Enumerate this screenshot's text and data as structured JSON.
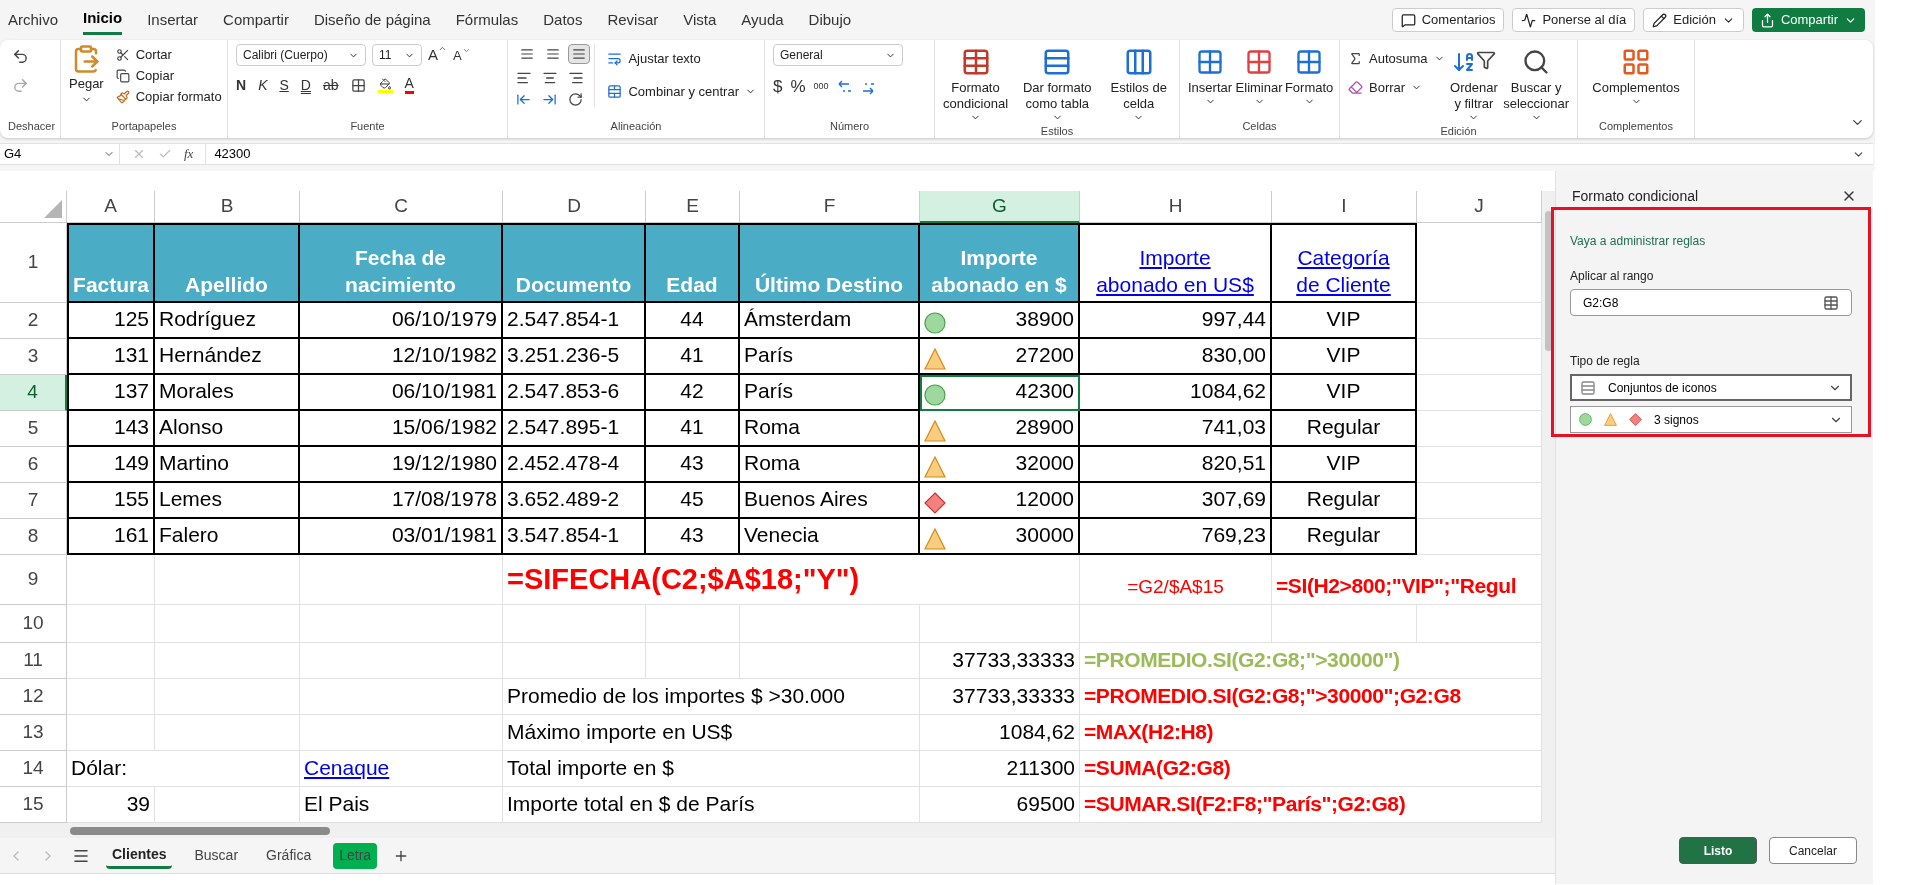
{
  "menu_tabs": [
    {
      "label": "Archivo",
      "selected": false
    },
    {
      "label": "Inicio",
      "selected": true
    },
    {
      "label": "Insertar",
      "selected": false
    },
    {
      "label": "Compartir",
      "selected": false
    },
    {
      "label": "Diseño de página",
      "selected": false
    },
    {
      "label": "Fórmulas",
      "selected": false
    },
    {
      "label": "Datos",
      "selected": false
    },
    {
      "label": "Revisar",
      "selected": false
    },
    {
      "label": "Vista",
      "selected": false
    },
    {
      "label": "Ayuda",
      "selected": false
    },
    {
      "label": "Dibujo",
      "selected": false
    }
  ],
  "top_buttons": [
    {
      "label": "Comentarios",
      "kind": "comments"
    },
    {
      "label": "Ponerse al día",
      "kind": "catchup"
    },
    {
      "label": "Edición",
      "kind": "editing"
    },
    {
      "label": "Compartir",
      "kind": "share"
    }
  ],
  "ribbon": {
    "undo": {
      "label": "Deshacer"
    },
    "clipboard": {
      "label": "Portapapeles",
      "paste": "Pegar",
      "items": [
        "Cortar",
        "Copiar",
        "Copiar formato"
      ]
    },
    "font": {
      "label": "Fuente",
      "family": "Calibri (Cuerpo)",
      "size": "11",
      "grow": "A",
      "shrink": "A",
      "styles": [
        "N",
        "K",
        "S",
        "D",
        "ab"
      ],
      "color_letter": "A"
    },
    "alignment": {
      "label": "Alineación",
      "vertical": [
        {
          "selected": false
        },
        {
          "selected": false
        },
        {
          "selected": true
        }
      ],
      "wrap": "Ajustar texto",
      "merge": "Combinar y centrar"
    },
    "number": {
      "label": "Número",
      "format": "General",
      "symbols": [
        "$",
        "%",
        "000"
      ]
    },
    "styles": {
      "label": "Estilos",
      "items": [
        "Formato condicional",
        "Dar formato como tabla",
        "Estilos de celda"
      ]
    },
    "cells": {
      "label": "Celdas",
      "items": [
        "Insertar",
        "Eliminar",
        "Formato"
      ]
    },
    "editing": {
      "label": "Edición",
      "autosum": "Autosuma",
      "clear": "Borrar",
      "items": [
        "Ordenar y filtrar",
        "Buscar y seleccionar"
      ]
    },
    "addins": {
      "label": "Complementos",
      "items": [
        "Complementos"
      ]
    }
  },
  "formula_bar": {
    "name_box": "G4",
    "fx": "fx",
    "value": "42300"
  },
  "sheet": {
    "columns": [
      {
        "label": "A",
        "selected": false
      },
      {
        "label": "B",
        "selected": false
      },
      {
        "label": "C",
        "selected": false
      },
      {
        "label": "D",
        "selected": false
      },
      {
        "label": "E",
        "selected": false
      },
      {
        "label": "F",
        "selected": false
      },
      {
        "label": "G",
        "selected": true
      },
      {
        "label": "H",
        "selected": false
      },
      {
        "label": "I",
        "selected": false
      },
      {
        "label": "J",
        "selected": false
      }
    ],
    "rows": [
      {
        "number": "1",
        "selected": false,
        "bordered": true,
        "cells": {
          "A": {
            "text": "Factura",
            "kind": "header"
          },
          "B": {
            "text": "Apellido",
            "kind": "header"
          },
          "C": {
            "text": "Fecha de\nnacimiento",
            "kind": "header"
          },
          "D": {
            "text": "Documento",
            "kind": "header"
          },
          "E": {
            "text": "Edad",
            "kind": "header"
          },
          "F": {
            "text": "Último Destino",
            "kind": "header"
          },
          "G": {
            "text": "Importe\nabonado en $",
            "kind": "header"
          },
          "H": {
            "text": "Importe\nabonado en US$",
            "kind": "link-header"
          },
          "I": {
            "text": "Categoría\nde Cliente",
            "kind": "link-header"
          }
        }
      },
      {
        "number": "2",
        "selected": false,
        "bordered": true,
        "cells": {
          "A": {
            "text": "125",
            "kind": "number"
          },
          "B": {
            "text": "Rodríguez",
            "kind": "text"
          },
          "C": {
            "text": "06/10/1979",
            "kind": "number"
          },
          "D": {
            "text": "2.547.854-1",
            "kind": "text"
          },
          "E": {
            "text": "44",
            "kind": "centered"
          },
          "F": {
            "text": "Ámsterdam",
            "kind": "text"
          },
          "G": {
            "text": "38900",
            "kind": "number",
            "marker": {
              "kind": "circle"
            }
          },
          "H": {
            "text": "997,44",
            "kind": "number"
          },
          "I": {
            "text": "VIP",
            "kind": "centered"
          }
        }
      },
      {
        "number": "3",
        "selected": false,
        "bordered": true,
        "cells": {
          "A": {
            "text": "131",
            "kind": "number"
          },
          "B": {
            "text": "Hernández",
            "kind": "text"
          },
          "C": {
            "text": "12/10/1982",
            "kind": "number"
          },
          "D": {
            "text": "3.251.236-5",
            "kind": "text"
          },
          "E": {
            "text": "41",
            "kind": "centered"
          },
          "F": {
            "text": "París",
            "kind": "text"
          },
          "G": {
            "text": "27200",
            "kind": "number",
            "marker": {
              "kind": "triangle"
            }
          },
          "H": {
            "text": "830,00",
            "kind": "number"
          },
          "I": {
            "text": "VIP",
            "kind": "centered"
          }
        }
      },
      {
        "number": "4",
        "selected": true,
        "bordered": true,
        "cells": {
          "A": {
            "text": "137",
            "kind": "number"
          },
          "B": {
            "text": "Morales",
            "kind": "text"
          },
          "C": {
            "text": "06/10/1981",
            "kind": "number"
          },
          "D": {
            "text": "2.547.853-6",
            "kind": "text"
          },
          "E": {
            "text": "42",
            "kind": "centered"
          },
          "F": {
            "text": "París",
            "kind": "text"
          },
          "G": {
            "text": "42300",
            "kind": "number",
            "marker": {
              "kind": "circle"
            }
          },
          "H": {
            "text": "1084,62",
            "kind": "number"
          },
          "I": {
            "text": "VIP",
            "kind": "centered"
          }
        }
      },
      {
        "number": "5",
        "selected": false,
        "bordered": true,
        "cells": {
          "A": {
            "text": "143",
            "kind": "number"
          },
          "B": {
            "text": "Alonso",
            "kind": "text"
          },
          "C": {
            "text": "15/06/1982",
            "kind": "number"
          },
          "D": {
            "text": "2.547.895-1",
            "kind": "text"
          },
          "E": {
            "text": "41",
            "kind": "centered"
          },
          "F": {
            "text": "Roma",
            "kind": "text"
          },
          "G": {
            "text": "28900",
            "kind": "number",
            "marker": {
              "kind": "triangle"
            }
          },
          "H": {
            "text": "741,03",
            "kind": "number"
          },
          "I": {
            "text": "Regular",
            "kind": "centered"
          }
        }
      },
      {
        "number": "6",
        "selected": false,
        "bordered": true,
        "cells": {
          "A": {
            "text": "149",
            "kind": "number"
          },
          "B": {
            "text": "Martino",
            "kind": "text"
          },
          "C": {
            "text": "19/12/1980",
            "kind": "number"
          },
          "D": {
            "text": "2.452.478-4",
            "kind": "text"
          },
          "E": {
            "text": "43",
            "kind": "centered"
          },
          "F": {
            "text": "Roma",
            "kind": "text"
          },
          "G": {
            "text": "32000",
            "kind": "number",
            "marker": {
              "kind": "triangle"
            }
          },
          "H": {
            "text": "820,51",
            "kind": "number"
          },
          "I": {
            "text": "VIP",
            "kind": "centered"
          }
        }
      },
      {
        "number": "7",
        "selected": false,
        "bordered": true,
        "cells": {
          "A": {
            "text": "155",
            "kind": "number"
          },
          "B": {
            "text": "Lemes",
            "kind": "text"
          },
          "C": {
            "text": "17/08/1978",
            "kind": "number"
          },
          "D": {
            "text": "3.652.489-2",
            "kind": "text"
          },
          "E": {
            "text": "45",
            "kind": "centered"
          },
          "F": {
            "text": "Buenos Aires",
            "kind": "text"
          },
          "G": {
            "text": "12000",
            "kind": "number",
            "marker": {
              "kind": "diamond"
            }
          },
          "H": {
            "text": "307,69",
            "kind": "number"
          },
          "I": {
            "text": "Regular",
            "kind": "centered"
          }
        }
      },
      {
        "number": "8",
        "selected": false,
        "bordered": true,
        "cells": {
          "A": {
            "text": "161",
            "kind": "number"
          },
          "B": {
            "text": "Falero",
            "kind": "text"
          },
          "C": {
            "text": "03/01/1981",
            "kind": "number"
          },
          "D": {
            "text": "3.547.854-1",
            "kind": "text"
          },
          "E": {
            "text": "43",
            "kind": "centered"
          },
          "F": {
            "text": "Venecia",
            "kind": "text"
          },
          "G": {
            "text": "30000",
            "kind": "number",
            "marker": {
              "kind": "triangle"
            }
          },
          "H": {
            "text": "769,23",
            "kind": "number"
          },
          "I": {
            "text": "Regular",
            "kind": "centered"
          }
        }
      },
      {
        "number": "9",
        "selected": false,
        "bordered": false,
        "cells": {
          "D": {
            "text": "=SIFECHA(C2;$A$18;\"Y\")",
            "kind": "formula-big"
          },
          "H": {
            "text": "=G2/$A$15",
            "kind": "formula-small"
          },
          "I": {
            "text": "=SI(H2>800;\"VIP\";\"Regul",
            "kind": "formula"
          }
        }
      },
      {
        "number": "10",
        "selected": false,
        "bordered": false,
        "cells": {}
      },
      {
        "number": "11",
        "selected": false,
        "bordered": false,
        "cells": {
          "G": {
            "text": "37733,33333",
            "kind": "number"
          },
          "H": {
            "text": "=PROMEDIO.SI(G2:G8;\">30000\")",
            "kind": "formula-green"
          }
        }
      },
      {
        "number": "12",
        "selected": false,
        "bordered": false,
        "cells": {
          "D": {
            "text": "Promedio de los importes $ >30.000",
            "kind": "text"
          },
          "G": {
            "text": "37733,33333",
            "kind": "number"
          },
          "H": {
            "text": "=PROMEDIO.SI(G2:G8;\">30000\";G2:G8",
            "kind": "formula"
          }
        }
      },
      {
        "number": "13",
        "selected": false,
        "bordered": false,
        "cells": {
          "D": {
            "text": "Máximo importe en US$",
            "kind": "text"
          },
          "G": {
            "text": "1084,62",
            "kind": "number"
          },
          "H": {
            "text": "=MAX(H2:H8)",
            "kind": "formula"
          }
        }
      },
      {
        "number": "14",
        "selected": false,
        "bordered": false,
        "cells": {
          "A": {
            "text": "Dólar:",
            "kind": "text"
          },
          "C": {
            "text": "Cenaque",
            "kind": "link"
          },
          "D": {
            "text": "Total importe en $",
            "kind": "text"
          },
          "G": {
            "text": "211300",
            "kind": "number"
          },
          "H": {
            "text": "=SUMA(G2:G8)",
            "kind": "formula"
          }
        }
      },
      {
        "number": "15",
        "selected": false,
        "bordered": false,
        "cells": {
          "A": {
            "text": "39",
            "kind": "number"
          },
          "C": {
            "text": "El Pais",
            "kind": "text"
          },
          "D": {
            "text": "Importe total en $ de París",
            "kind": "text"
          },
          "G": {
            "text": "69500",
            "kind": "number"
          },
          "H": {
            "text": "=SUMAR.SI(F2:F8;\"París\";G2:G8)",
            "kind": "formula"
          }
        }
      }
    ]
  },
  "sheet_tabs": [
    {
      "label": "Clientes",
      "selected": true
    },
    {
      "label": "Buscar",
      "selected": false
    },
    {
      "label": "Gráfica",
      "selected": false
    },
    {
      "label": "Letra",
      "selected": false,
      "color": "#00b050"
    }
  ],
  "panel": {
    "title": "Formato condicional",
    "manage_link": "Vaya a administrar reglas",
    "range_label": "Aplicar al rango",
    "range_value": "G2:G8",
    "rule_label": "Tipo de regla",
    "rule_value": "Conjuntos de iconos",
    "icon_set": "3 signos",
    "buttons": [
      {
        "label": "Listo",
        "kind": "primary"
      },
      {
        "label": "Cancelar",
        "kind": "secondary"
      }
    ]
  }
}
